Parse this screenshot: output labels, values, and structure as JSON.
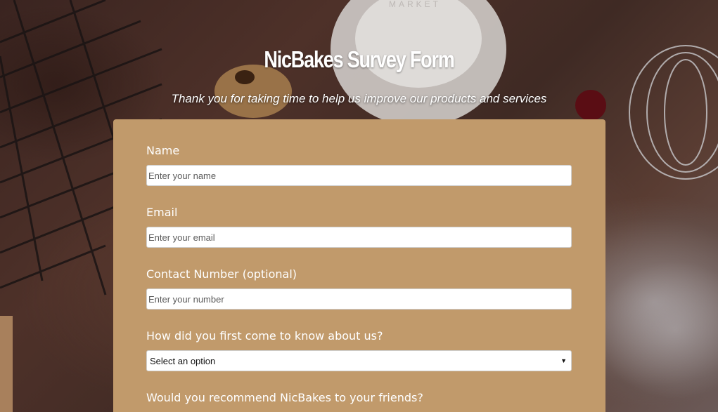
{
  "header": {
    "title": "NicBakes Survey Form",
    "subtitle": "Thank you for taking time to help us improve our products and services"
  },
  "background": {
    "jar_text": "MARKET"
  },
  "form": {
    "name": {
      "label": "Name",
      "placeholder": "Enter your name"
    },
    "email": {
      "label": "Email",
      "placeholder": "Enter your email"
    },
    "contact": {
      "label": "Contact Number (optional)",
      "placeholder": "Enter your number"
    },
    "source": {
      "label": "How did you first come to know about us?",
      "selected": "Select an option"
    },
    "recommend": {
      "label": "Would you recommend NicBakes to your friends?"
    }
  },
  "colors": {
    "card": "#c19a6b",
    "text": "#ffffff"
  }
}
